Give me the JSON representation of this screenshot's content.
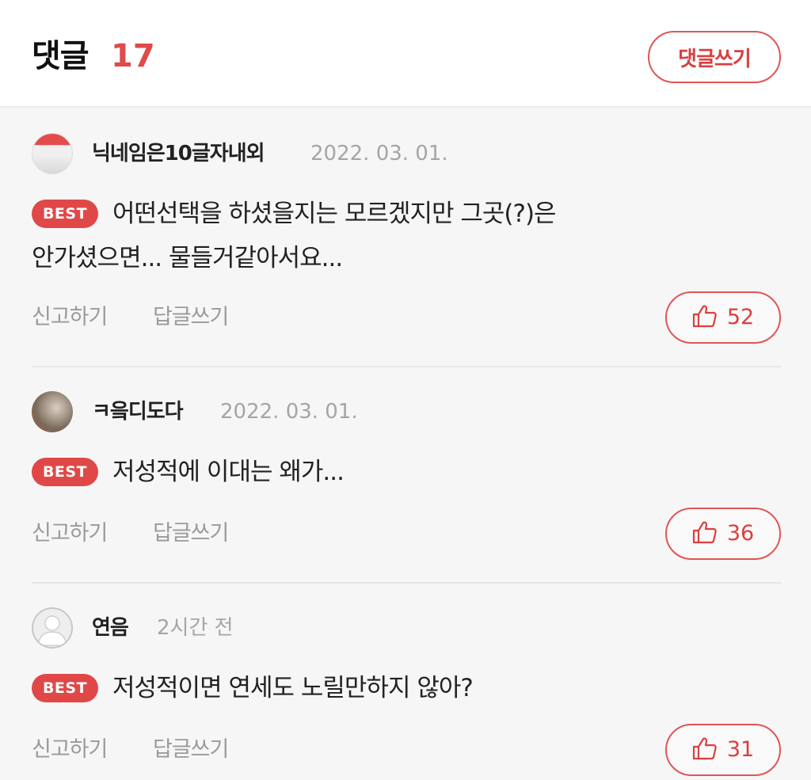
{
  "header": {
    "title": "댓글",
    "count": "17",
    "write_button": "댓글쓰기"
  },
  "comments": [
    {
      "nickname": "닉네임은10글자내외",
      "date": "2022. 03. 01.",
      "badge": "BEST",
      "lines": [
        "어떤선택을 하셨을지는 모르겠지만 그곳(?)은",
        "안가셨으면... 물들거같아서요..."
      ],
      "report": "신고하기",
      "reply": "답글쓰기",
      "likes": "52"
    },
    {
      "nickname": "ㅋ읔디도다",
      "date": "2022. 03. 01.",
      "badge": "BEST",
      "lines": [
        "저성적에 이대는 왜가..."
      ],
      "report": "신고하기",
      "reply": "답글쓰기",
      "likes": "36"
    },
    {
      "nickname": "연음",
      "date": "2시간 전",
      "badge": "BEST",
      "lines": [
        "저성적이면 연세도 노릴만하지 않아?"
      ],
      "report": "신고하기",
      "reply": "답글쓰기",
      "likes": "31"
    }
  ],
  "colors": {
    "accent": "#e04848",
    "muted": "#9a9a9a",
    "background": "#f6f6f6"
  }
}
